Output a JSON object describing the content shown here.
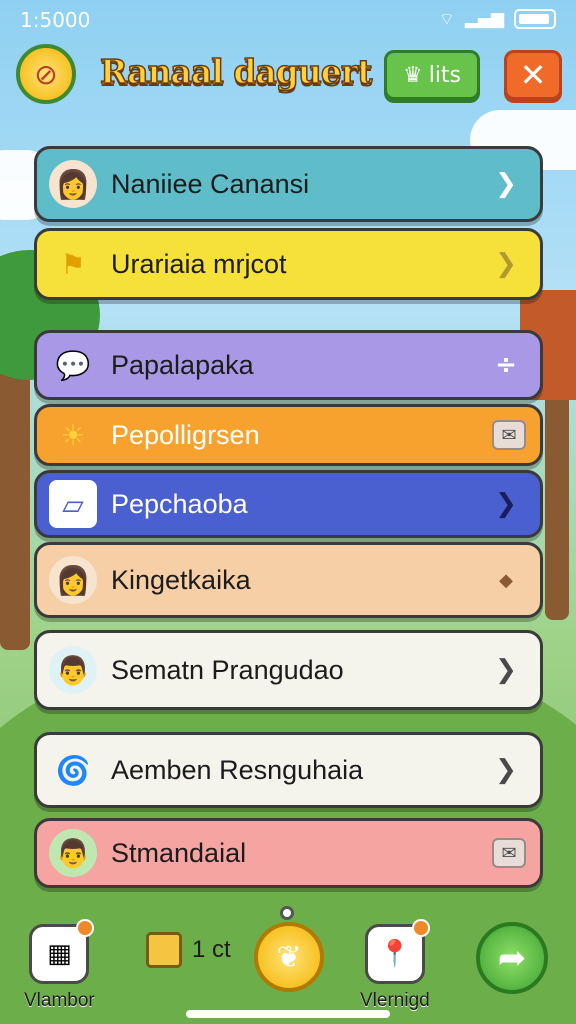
{
  "status_bar": {
    "time": "1:5000"
  },
  "header": {
    "title": "Ranaal daguert",
    "lits_label": "lits",
    "close_label": "✕"
  },
  "rows": [
    {
      "label": "Naniiee Canansi",
      "bg": "#5fbcc9",
      "icon": "avatar-icon",
      "icon_glyph": "👩",
      "chevron": "❯"
    },
    {
      "label": "Urariaia mrjcot",
      "bg": "#f6e03a",
      "icon": "flag-icon",
      "icon_glyph": "⚑",
      "chevron": "❯"
    },
    {
      "label": "Papalapaka",
      "bg": "#a898e6",
      "icon": "chat-icon",
      "icon_glyph": "💬",
      "chevron": "÷"
    },
    {
      "label": "Pepolligrsen",
      "bg": "#f7a22e",
      "icon": "sun-icon",
      "icon_glyph": "☀",
      "chevron": "✉"
    },
    {
      "label": "Pepchaoba",
      "bg": "#4a5fd0",
      "icon": "document-icon",
      "icon_glyph": "▱",
      "chevron": "❯"
    },
    {
      "label": "Kingetkaika",
      "bg": "#f7cfa6",
      "icon": "avatar-icon",
      "icon_glyph": "👩",
      "chevron": "◆"
    },
    {
      "label": "Sematn Prangudao",
      "bg": "#f4f4ec",
      "icon": "avatar-icon",
      "icon_glyph": "👨",
      "chevron": "❯"
    },
    {
      "label": "Aemben Resnguhaia",
      "bg": "#f4f4ec",
      "icon": "swirl-icon",
      "icon_glyph": "🌀",
      "chevron": "❯"
    },
    {
      "label": "Stmandaial",
      "bg": "#f6a4a2",
      "icon": "avatar-icon",
      "icon_glyph": "👨",
      "chevron": "✉"
    }
  ],
  "bottom_nav": {
    "left_label": "Vlambor",
    "cube_count": "1 ct",
    "right_label": "Vlernigd"
  }
}
